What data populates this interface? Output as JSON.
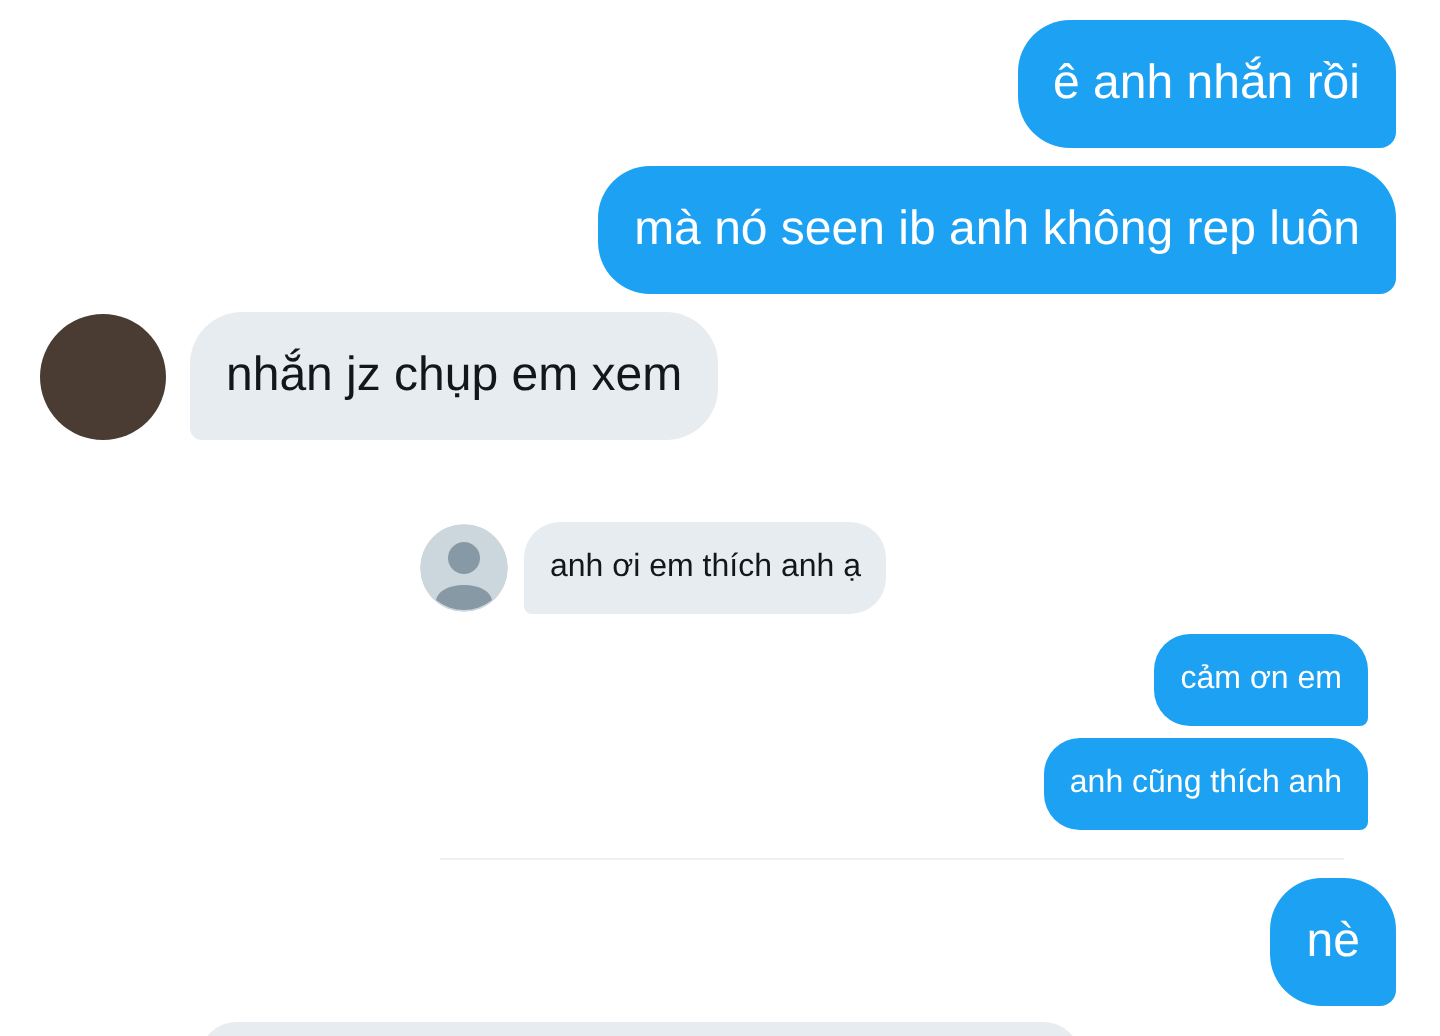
{
  "messages": [
    {
      "kind": "outgoing",
      "compact": false,
      "text": "ê anh nhắn rồi"
    },
    {
      "kind": "outgoing",
      "compact": false,
      "text": "mà nó seen ib anh không rep luôn"
    },
    {
      "kind": "incoming",
      "compact": false,
      "text": "nhắn jz chụp em xem",
      "avatar": {
        "kind": "photo"
      }
    },
    {
      "kind": "incoming",
      "compact": true,
      "text": "anh ơi em thích anh ạ",
      "avatar": {
        "kind": "silhouette"
      }
    },
    {
      "kind": "outgoing",
      "compact": true,
      "text": "cảm ơn em"
    },
    {
      "kind": "outgoing",
      "compact": true,
      "text": "anh cũng thích anh"
    },
    {
      "kind": "divider"
    },
    {
      "kind": "outgoing",
      "compact": false,
      "text": "nè"
    },
    {
      "kind": "blank"
    }
  ]
}
